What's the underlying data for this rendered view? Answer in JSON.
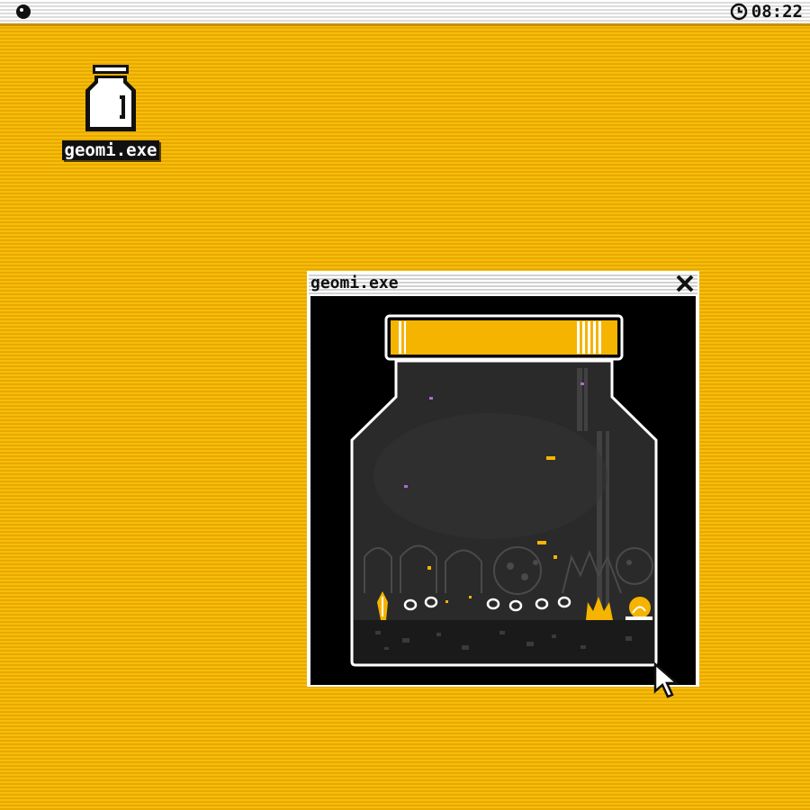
{
  "menubar": {
    "clock_time": "08:22",
    "icons": [
      "dot-menu-icon",
      "clock-icon"
    ]
  },
  "desktop": {
    "icon_label": "geomi.exe",
    "icon_name": "jar-icon"
  },
  "window": {
    "title": "geomi.exe",
    "close_icon": "close-icon"
  },
  "colors": {
    "desktop": "#f2b705",
    "accent": "#f5b400",
    "window_bg": "#000000",
    "text": "#111111"
  }
}
